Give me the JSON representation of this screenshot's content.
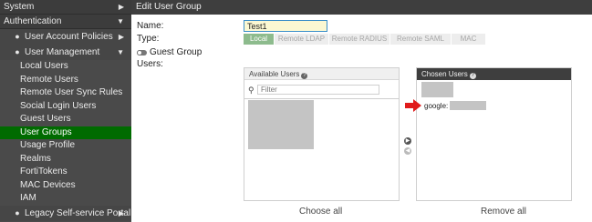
{
  "sidebar": {
    "system": "System",
    "authentication": "Authentication",
    "user_account_policies": "User Account Policies",
    "user_management": "User Management",
    "items": [
      {
        "label": "Local Users"
      },
      {
        "label": "Remote Users"
      },
      {
        "label": "Remote User Sync Rules"
      },
      {
        "label": "Social Login Users"
      },
      {
        "label": "Guest Users"
      },
      {
        "label": "User Groups",
        "active": true
      },
      {
        "label": "Usage Profile"
      },
      {
        "label": "Realms"
      },
      {
        "label": "FortiTokens"
      },
      {
        "label": "MAC Devices"
      },
      {
        "label": "IAM"
      }
    ],
    "legacy_portal": "Legacy Self-service Portal"
  },
  "main": {
    "title": "Edit User Group",
    "name_label": "Name:",
    "name_value": "Test1",
    "type_label": "Type:",
    "types": [
      {
        "label": "Local",
        "active": true
      },
      {
        "label": "Remote LDAP"
      },
      {
        "label": "Remote RADIUS"
      },
      {
        "label": "Remote SAML"
      },
      {
        "label": "MAC"
      }
    ],
    "guest_group_label": "Guest Group",
    "users_label": "Users:",
    "available": {
      "header": "Available Users",
      "filter_placeholder": "Filter",
      "choose_all": "Choose all"
    },
    "chosen": {
      "header": "Chosen Users",
      "item_prefix": "google:",
      "remove_all": "Remove all"
    }
  },
  "colors": {
    "accent_green": "#006b00",
    "type_active": "#8dbb8d",
    "header_dark": "#3e3e3e",
    "arrow_red": "#e01b1b"
  }
}
